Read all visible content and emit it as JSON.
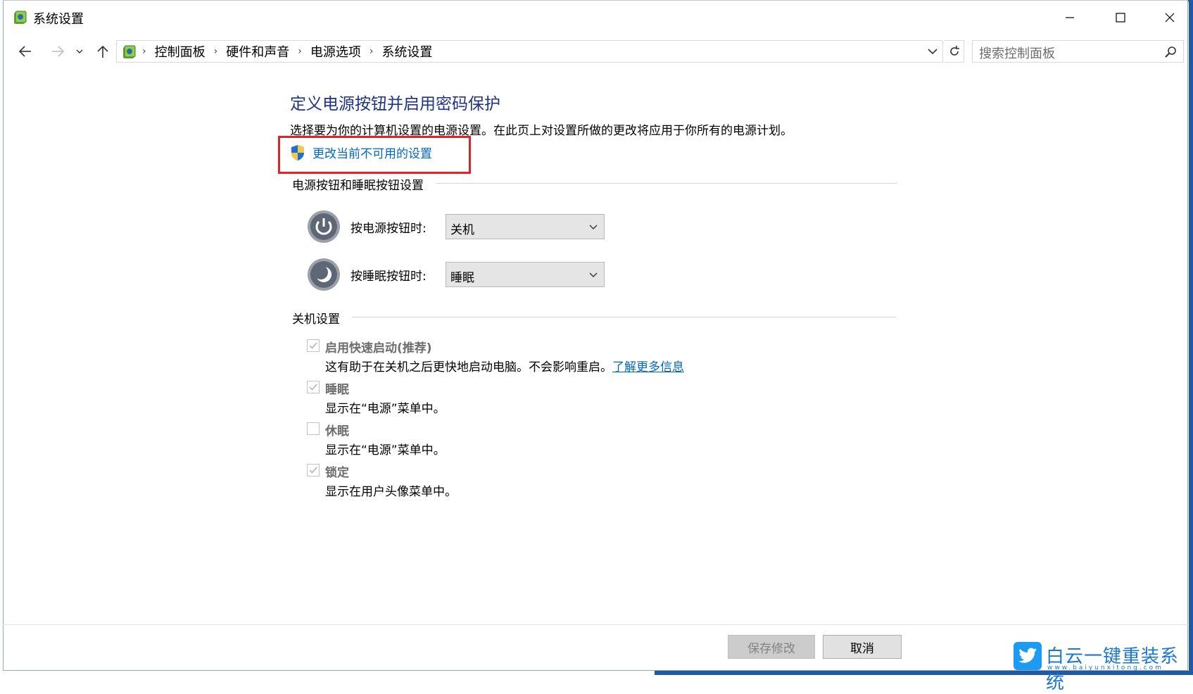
{
  "window": {
    "title": "系统设置",
    "minimize": "—",
    "maximize": "☐",
    "close": "✕"
  },
  "address": {
    "crumbs": [
      "控制面板",
      "硬件和声音",
      "电源选项",
      "系统设置"
    ],
    "search_placeholder": "搜索控制面板"
  },
  "content": {
    "heading": "定义电源按钮并启用密码保护",
    "description": "选择要为你的计算机设置的电源设置。在此页上对设置所做的更改将应用于你所有的电源计划。",
    "admin_link": "更改当前不可用的设置",
    "power_group": {
      "title": "电源按钮和睡眠按钮设置",
      "power_label": "按电源按钮时:",
      "power_value": "关机",
      "sleep_label": "按睡眠按钮时:",
      "sleep_value": "睡眠"
    },
    "shutdown_group": {
      "title": "关机设置",
      "items": [
        {
          "label": "启用快速启动(推荐)",
          "desc": "这有助于在关机之后更快地启动电脑。不会影响重启。",
          "link": "了解更多信息",
          "checked": true
        },
        {
          "label": "睡眠",
          "desc": "显示在“电源”菜单中。",
          "checked": true
        },
        {
          "label": "休眠",
          "desc": "显示在“电源”菜单中。",
          "checked": false
        },
        {
          "label": "锁定",
          "desc": "显示在用户头像菜单中。",
          "checked": true
        }
      ]
    }
  },
  "buttons": {
    "save": "保存修改",
    "cancel": "取消"
  },
  "watermark": {
    "text": "白云一键重装系统",
    "url": "www.baiyunxitong.com"
  },
  "colors": {
    "heading": "#1e3287",
    "link": "#0066cc",
    "highlight": "#e32227",
    "accent_strip": "#1f5aa8"
  }
}
